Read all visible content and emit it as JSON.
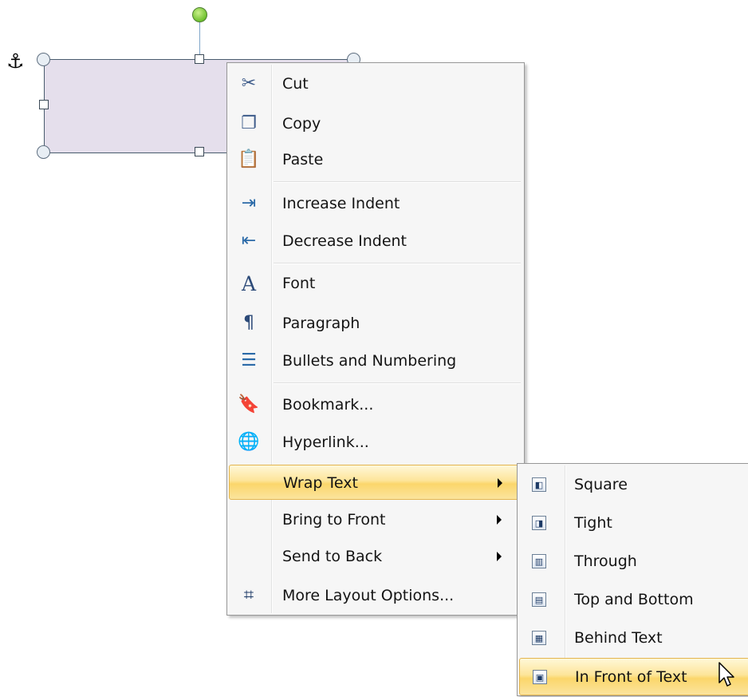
{
  "canvas": {
    "anchor_icon": "anchor-icon",
    "anchor_glyph": "⚓"
  },
  "context_menu": {
    "items": [
      {
        "label": "Cut",
        "icon": "scissors-icon",
        "glyph": "✂",
        "color": "#3d5b8a"
      },
      {
        "label": "Copy",
        "icon": "copy-icon",
        "glyph": "❐",
        "color": "#3d5b8a"
      },
      {
        "label": "Paste",
        "icon": "paste-icon",
        "glyph": "📋",
        "color": "#b07a2a"
      },
      {
        "label": "Increase Indent",
        "icon": "increase-indent-icon",
        "glyph": "⇥",
        "color": "#2b6aa8"
      },
      {
        "label": "Decrease Indent",
        "icon": "decrease-indent-icon",
        "glyph": "⇤",
        "color": "#2b6aa8"
      },
      {
        "label": "Font",
        "icon": "font-icon",
        "glyph": "A",
        "color": "#2c4a78"
      },
      {
        "label": "Paragraph",
        "icon": "paragraph-icon",
        "glyph": "¶",
        "color": "#2c4a78"
      },
      {
        "label": "Bullets and Numbering",
        "icon": "bullets-icon",
        "glyph": "☰",
        "color": "#2b6aa8"
      },
      {
        "label": "Bookmark...",
        "icon": "bookmark-icon",
        "glyph": "🔖",
        "color": "#c0392b"
      },
      {
        "label": "Hyperlink...",
        "icon": "hyperlink-icon",
        "glyph": "🌐",
        "color": "#2e7d32"
      },
      {
        "label": "Wrap Text",
        "icon": "",
        "glyph": "",
        "color": "",
        "has_submenu": true,
        "highlighted": true
      },
      {
        "label": "Bring to Front",
        "icon": "",
        "glyph": "",
        "color": "",
        "has_submenu": true
      },
      {
        "label": "Send to Back",
        "icon": "",
        "glyph": "",
        "color": "",
        "has_submenu": true
      },
      {
        "label": "More Layout Options...",
        "icon": "layout-options-icon",
        "glyph": "⌗",
        "color": "#1d3a66"
      }
    ]
  },
  "wrap_submenu": {
    "items": [
      {
        "label": "Square",
        "icon": "wrap-square-icon"
      },
      {
        "label": "Tight",
        "icon": "wrap-tight-icon"
      },
      {
        "label": "Through",
        "icon": "wrap-through-icon"
      },
      {
        "label": "Top and Bottom",
        "icon": "wrap-top-bottom-icon"
      },
      {
        "label": "Behind Text",
        "icon": "wrap-behind-text-icon"
      },
      {
        "label": "In Front of Text",
        "icon": "wrap-in-front-icon",
        "highlighted": true
      }
    ]
  },
  "colors": {
    "highlight": "#fbd66b",
    "shape_fill": "#e5dfec",
    "rotate_handle": "#6fc12e"
  }
}
